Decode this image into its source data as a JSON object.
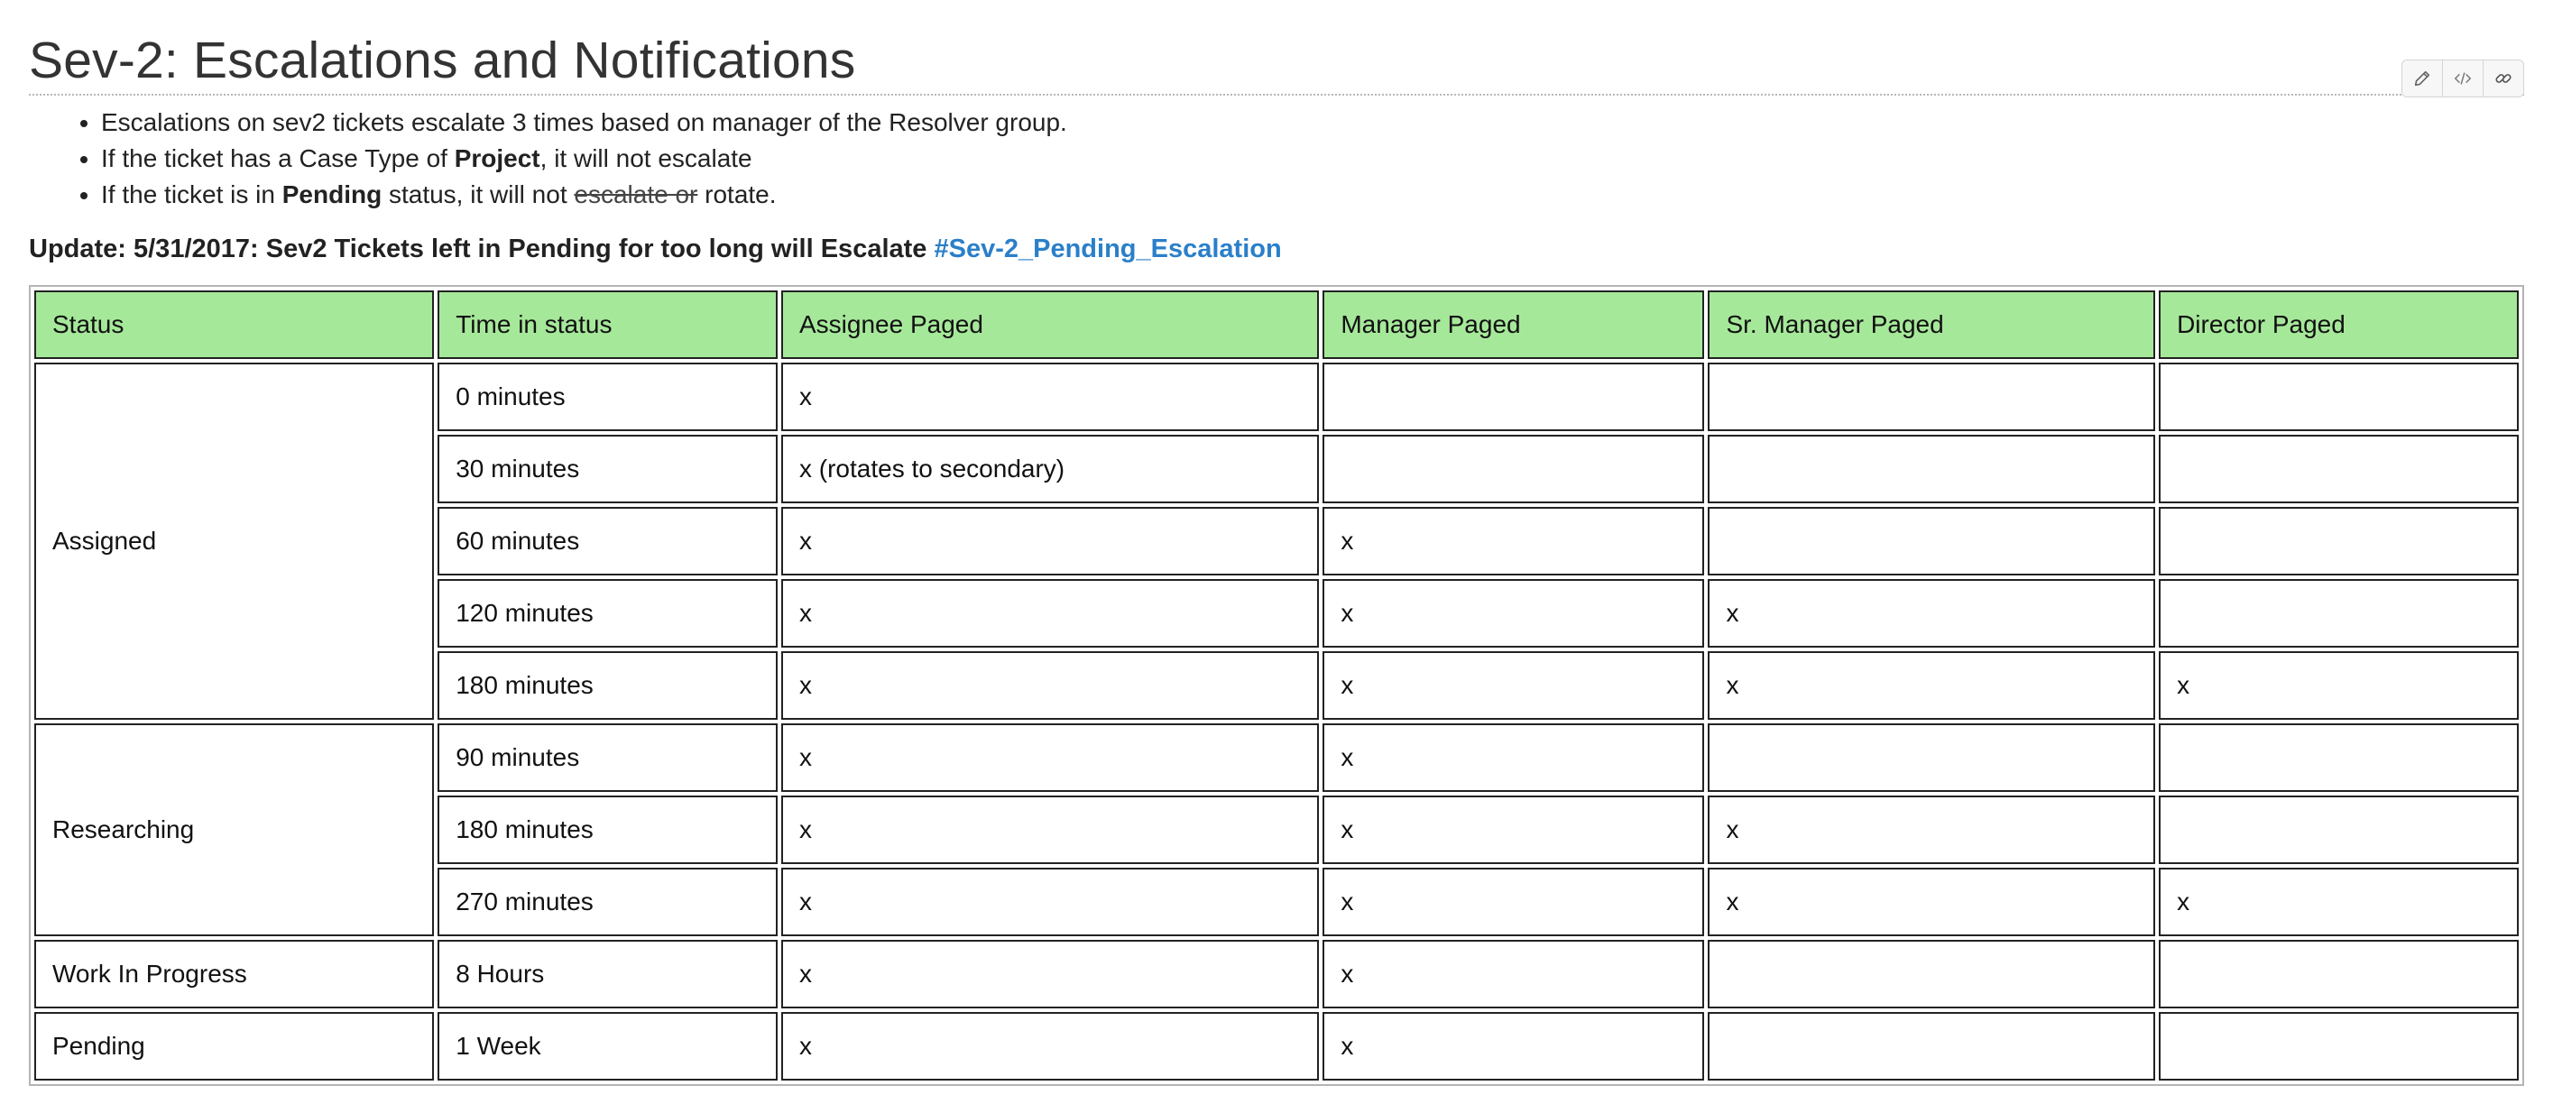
{
  "page": {
    "title": "Sev-2: Escalations and Notifications"
  },
  "toolbar": {
    "icons": [
      "pencil-icon",
      "code-icon",
      "link-icon"
    ]
  },
  "bullets": {
    "b1": {
      "text": "Escalations on sev2 tickets escalate 3 times based on manager of the Resolver group."
    },
    "b2": {
      "pre": "If the ticket has a Case Type of ",
      "bold": "Project",
      "post": ", it will not escalate"
    },
    "b3": {
      "pre": "If the ticket is in ",
      "bold": "Pending",
      "mid": " status, it will not ",
      "strike": "escalate or",
      "post": " rotate."
    }
  },
  "update": {
    "text": "Update: 5/31/2017: Sev2 Tickets left in Pending for too long will Escalate ",
    "link": "#Sev-2_Pending_Escalation"
  },
  "table": {
    "headers": [
      "Status",
      "Time in status",
      "Assignee Paged",
      "Manager Paged",
      "Sr. Manager Paged",
      "Director Paged"
    ],
    "statuses": [
      "Assigned",
      "Researching",
      "Work In Progress",
      "Pending"
    ],
    "rows": [
      [
        "0 minutes",
        "x",
        "",
        "",
        ""
      ],
      [
        "30 minutes",
        "x (rotates to secondary)",
        "",
        "",
        ""
      ],
      [
        "60 minutes",
        "x",
        "x",
        "",
        ""
      ],
      [
        "120 minutes",
        "x",
        "x",
        "x",
        ""
      ],
      [
        "180 minutes",
        "x",
        "x",
        "x",
        "x"
      ],
      [
        "90 minutes",
        "x",
        "x",
        "",
        ""
      ],
      [
        "180 minutes",
        "x",
        "x",
        "x",
        ""
      ],
      [
        "270 minutes",
        "x",
        "x",
        "x",
        "x"
      ],
      [
        "8 Hours",
        "x",
        "x",
        "",
        ""
      ],
      [
        "1 Week",
        "x",
        "x",
        "",
        ""
      ]
    ]
  }
}
